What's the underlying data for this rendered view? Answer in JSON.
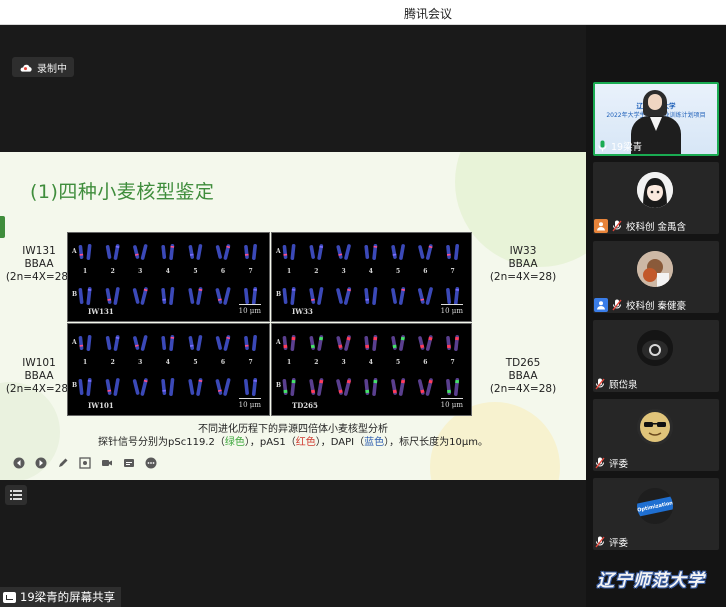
{
  "window": {
    "title": "腾讯会议"
  },
  "recording": {
    "label": "录制中"
  },
  "slide": {
    "title": "(1)四种小麦核型鉴定",
    "panels": [
      {
        "name": "IW131",
        "scale": "10 μm",
        "label_lines": [
          "IW131",
          "BBAA",
          "(2n=4X=28)"
        ]
      },
      {
        "name": "IW33",
        "scale": "10 μm",
        "label_lines": [
          "IW33",
          "BBAA",
          "(2n=4X=28)"
        ]
      },
      {
        "name": "IW101",
        "scale": "10 μm",
        "label_lines": [
          "IW101",
          "BBAA",
          "(2n=4X=28)"
        ]
      },
      {
        "name": "TD265",
        "scale": "10 μm",
        "label_lines": [
          "TD265",
          "BBAA",
          "(2n=4X=28)"
        ]
      }
    ],
    "row_labels": [
      "A",
      "B"
    ],
    "chromosome_numbers": [
      "1",
      "2",
      "3",
      "4",
      "5",
      "6",
      "7"
    ],
    "caption_line1": "不同进化历程下的异源四倍体小麦核型分析",
    "caption_line2": {
      "p1": "探针信号分别为pSc119.2（",
      "green": "绿色",
      "p2": "），pAS1（",
      "red": "红色",
      "p3": "），DAPI（",
      "blue": "蓝色",
      "p4": "），标尺长度为10μm。"
    }
  },
  "share": {
    "label": "19梁青的屏幕共享"
  },
  "participants": [
    {
      "name": "19梁青",
      "active": true,
      "slide_line1": "辽宁师范大学",
      "slide_line2": "2022年大学生创新创业训练计划项目"
    },
    {
      "name": "校科创 金禹含",
      "badge_color": "#e8843a"
    },
    {
      "name": "校科创 秦健豪",
      "badge_color": "#3a7de8"
    },
    {
      "name": "顾岱泉"
    },
    {
      "name": "评委"
    },
    {
      "name": "评委",
      "avatar_text": "Optimization"
    }
  ],
  "watermark": "辽宁师范大学"
}
